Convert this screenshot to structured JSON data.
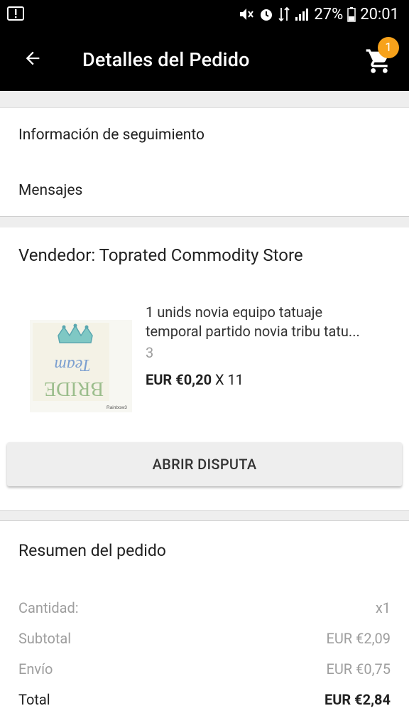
{
  "status_bar": {
    "battery": "27%",
    "time": "20:01"
  },
  "app_bar": {
    "title": "Detalles del Pedido",
    "cart_count": "1"
  },
  "tracking": {
    "tracking_label": "Información de seguimiento",
    "messages_label": "Mensajes"
  },
  "seller": {
    "name": "Vendedor: Toprated Commodity Store",
    "product": {
      "title_line1": "1 unids novia equipo tatuaje",
      "title_line2": "temporal partido novia tribu tatu...",
      "sku": "3",
      "price": "EUR €0,20",
      "qty": "X 11",
      "thumb_text1": "Team",
      "thumb_text2": "BRIDE",
      "thumb_caption": "Rainbow3"
    },
    "dispute_button": "ABRIR DISPUTA"
  },
  "summary": {
    "title": "Resumen del pedido",
    "rows": [
      {
        "label": "Cantidad:",
        "value": "x1"
      },
      {
        "label": "Subtotal",
        "value": "EUR €2,09"
      },
      {
        "label": "Envío",
        "value": "EUR €0,75"
      },
      {
        "label": "Total",
        "value": "EUR €2,84"
      }
    ]
  },
  "colors": {
    "app_bar": "#000000",
    "badge": "#f7a21b",
    "background": "#eeeeee"
  }
}
